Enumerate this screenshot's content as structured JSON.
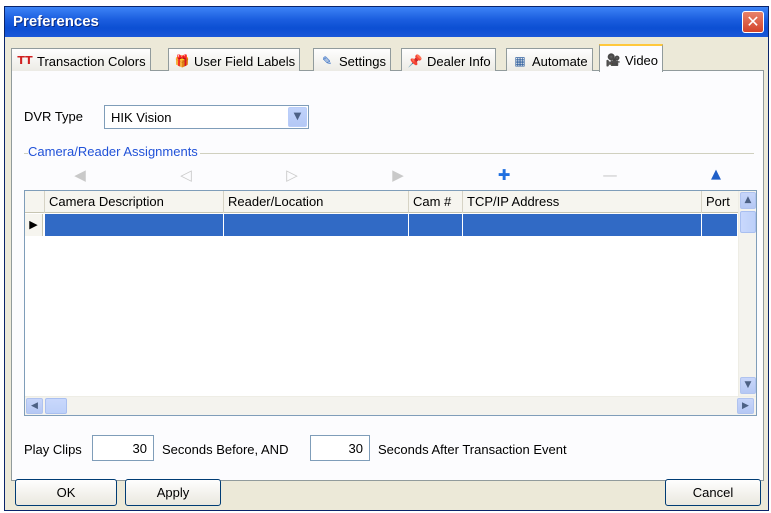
{
  "window": {
    "title": "Preferences",
    "close_glyph": "✕"
  },
  "tabs": [
    {
      "label": "Transaction Colors",
      "icon": "text-color-icon",
      "glyph": "TT"
    },
    {
      "label": "User Field Labels",
      "icon": "gift-icon",
      "glyph": "🎁"
    },
    {
      "label": "Settings",
      "icon": "edit-icon",
      "glyph": "✎"
    },
    {
      "label": "Dealer Info",
      "icon": "pushpin-icon",
      "glyph": "📌"
    },
    {
      "label": "Automate",
      "icon": "schedule-icon",
      "glyph": "▦"
    },
    {
      "label": "Video",
      "icon": "camera-icon",
      "glyph": "🎥",
      "active": true
    }
  ],
  "dvr": {
    "label": "DVR Type",
    "value": "HIK Vision",
    "arrow": "▼"
  },
  "group": {
    "label": "Camera/Reader Assignments"
  },
  "toolbar": {
    "first": "◀",
    "prev": "◁",
    "next": "▷",
    "last": "▶",
    "add": "✚",
    "remove": "—",
    "up": "▲"
  },
  "grid": {
    "columns": [
      "Camera Description",
      "Reader/Location",
      "Cam #",
      "TCP/IP Address",
      "Port"
    ],
    "row_indicator": "▶",
    "selected_row": [
      "",
      "",
      "",
      "",
      ""
    ]
  },
  "scroll": {
    "up": "▲",
    "down": "▼",
    "left": "◀",
    "right": "▶"
  },
  "clips": {
    "play_label": "Play Clips",
    "before_value": "30",
    "before_label": "Seconds Before, AND",
    "after_value": "30",
    "after_label": "Seconds After Transaction Event"
  },
  "buttons": {
    "ok": "OK",
    "apply": "Apply",
    "cancel": "Cancel"
  },
  "colors": {
    "title_bar": "#0c4fd3",
    "selection": "#316ac5",
    "group_label": "#2152d8",
    "active_tab_accent": "#ffc83c"
  }
}
